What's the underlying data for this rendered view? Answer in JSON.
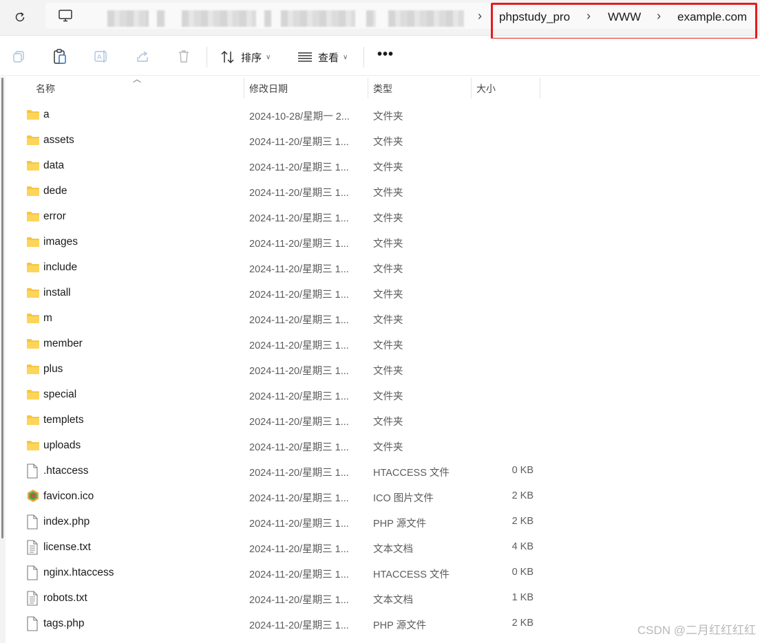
{
  "address_bar": {
    "breadcrumbs": [
      "phpstudy_pro",
      "WWW",
      "example.com"
    ],
    "highlight_color": "#e41b1b"
  },
  "toolbar": {
    "sort_label": "排序",
    "view_label": "查看",
    "more_label": "•••"
  },
  "columns": {
    "name": "名称",
    "modified": "修改日期",
    "type": "类型",
    "size": "大小"
  },
  "files": [
    {
      "name": "a",
      "date": "2024-10-28/星期一 2...",
      "type": "文件夹",
      "size": "",
      "icon": "folder-icon"
    },
    {
      "name": "assets",
      "date": "2024-11-20/星期三 1...",
      "type": "文件夹",
      "size": "",
      "icon": "folder-icon"
    },
    {
      "name": "data",
      "date": "2024-11-20/星期三 1...",
      "type": "文件夹",
      "size": "",
      "icon": "folder-icon"
    },
    {
      "name": "dede",
      "date": "2024-11-20/星期三 1...",
      "type": "文件夹",
      "size": "",
      "icon": "folder-icon"
    },
    {
      "name": "error",
      "date": "2024-11-20/星期三 1...",
      "type": "文件夹",
      "size": "",
      "icon": "folder-icon"
    },
    {
      "name": "images",
      "date": "2024-11-20/星期三 1...",
      "type": "文件夹",
      "size": "",
      "icon": "folder-icon"
    },
    {
      "name": "include",
      "date": "2024-11-20/星期三 1...",
      "type": "文件夹",
      "size": "",
      "icon": "folder-icon"
    },
    {
      "name": "install",
      "date": "2024-11-20/星期三 1...",
      "type": "文件夹",
      "size": "",
      "icon": "folder-icon"
    },
    {
      "name": "m",
      "date": "2024-11-20/星期三 1...",
      "type": "文件夹",
      "size": "",
      "icon": "folder-icon"
    },
    {
      "name": "member",
      "date": "2024-11-20/星期三 1...",
      "type": "文件夹",
      "size": "",
      "icon": "folder-icon"
    },
    {
      "name": "plus",
      "date": "2024-11-20/星期三 1...",
      "type": "文件夹",
      "size": "",
      "icon": "folder-icon"
    },
    {
      "name": "special",
      "date": "2024-11-20/星期三 1...",
      "type": "文件夹",
      "size": "",
      "icon": "folder-icon"
    },
    {
      "name": "templets",
      "date": "2024-11-20/星期三 1...",
      "type": "文件夹",
      "size": "",
      "icon": "folder-icon"
    },
    {
      "name": "uploads",
      "date": "2024-11-20/星期三 1...",
      "type": "文件夹",
      "size": "",
      "icon": "folder-icon"
    },
    {
      "name": ".htaccess",
      "date": "2024-11-20/星期三 1...",
      "type": "HTACCESS 文件",
      "size": "0 KB",
      "icon": "file-icon"
    },
    {
      "name": "favicon.ico",
      "date": "2024-11-20/星期三 1...",
      "type": "ICO 图片文件",
      "size": "2 KB",
      "icon": "image-file-icon"
    },
    {
      "name": "index.php",
      "date": "2024-11-20/星期三 1...",
      "type": "PHP 源文件",
      "size": "2 KB",
      "icon": "file-icon"
    },
    {
      "name": "license.txt",
      "date": "2024-11-20/星期三 1...",
      "type": "文本文档",
      "size": "4 KB",
      "icon": "text-file-icon"
    },
    {
      "name": "nginx.htaccess",
      "date": "2024-11-20/星期三 1...",
      "type": "HTACCESS 文件",
      "size": "0 KB",
      "icon": "file-icon"
    },
    {
      "name": "robots.txt",
      "date": "2024-11-20/星期三 1...",
      "type": "文本文档",
      "size": "1 KB",
      "icon": "text-file-icon"
    },
    {
      "name": "tags.php",
      "date": "2024-11-20/星期三 1...",
      "type": "PHP 源文件",
      "size": "2 KB",
      "icon": "file-icon"
    }
  ],
  "watermark": "CSDN @二月红红红红"
}
